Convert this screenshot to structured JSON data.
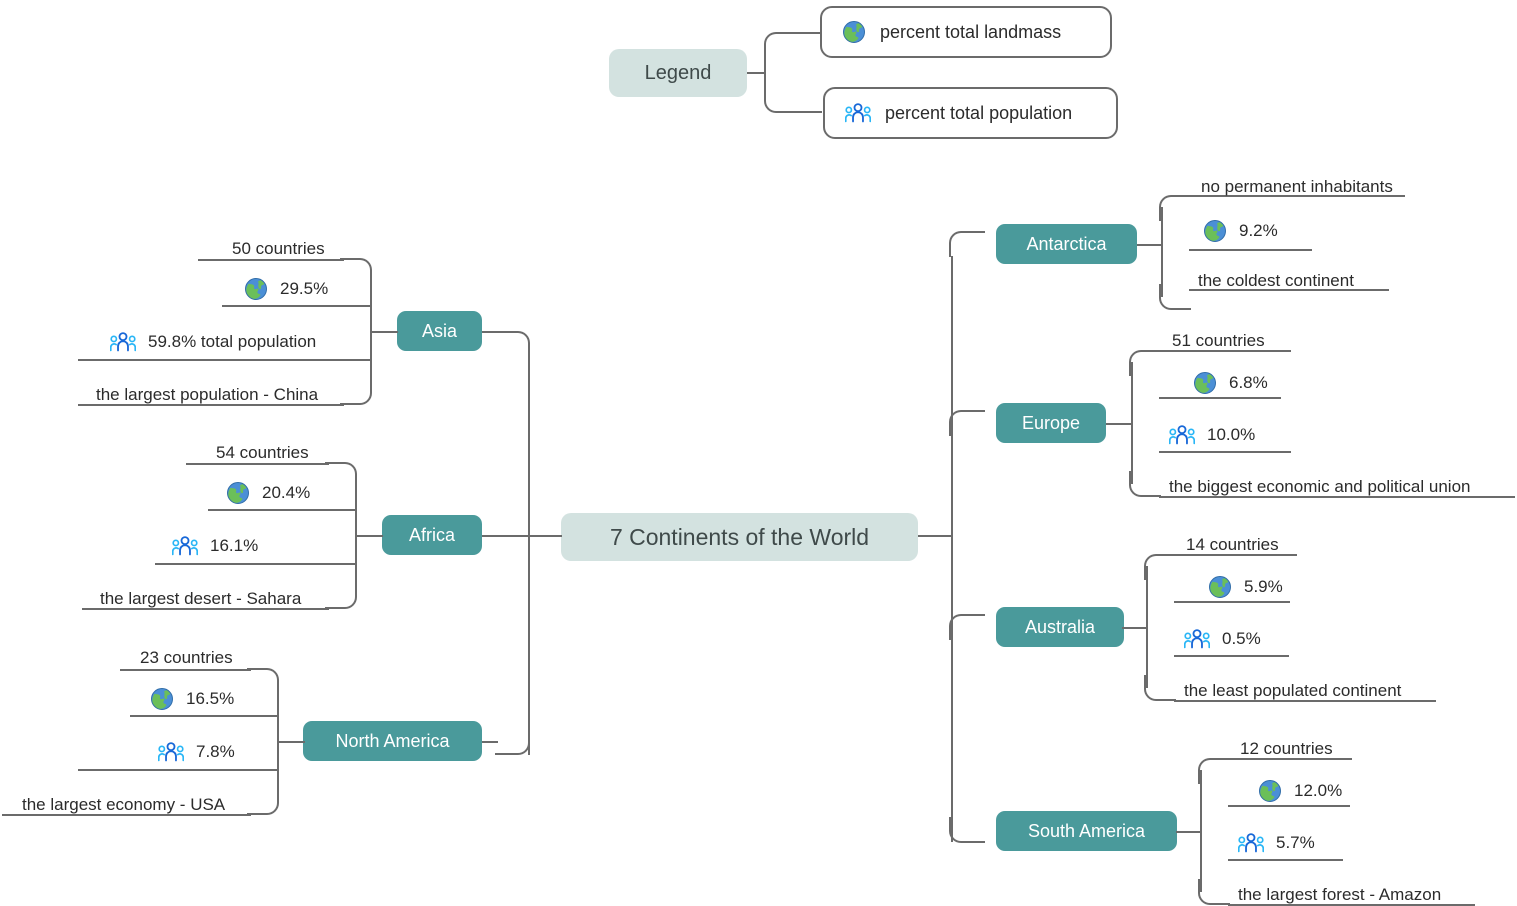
{
  "colors": {
    "branch_fill": "#4a9a9b",
    "root_fill": "#d3e2e0",
    "line": "#6b6b6b",
    "text": "#2b2b2b",
    "people_icon_dark": "#1868d8",
    "people_icon_light": "#29b6f6"
  },
  "root": {
    "label": "7 Continents of the World"
  },
  "legend": {
    "title": "Legend",
    "items": [
      {
        "icon": "globe-icon",
        "label": "percent total landmass"
      },
      {
        "icon": "people-icon",
        "label": "percent total population"
      }
    ]
  },
  "branches": [
    {
      "name": "Asia",
      "side": "left",
      "leaves": [
        {
          "icon": "none",
          "label": "50 countries"
        },
        {
          "icon": "globe-icon",
          "label": "29.5%"
        },
        {
          "icon": "people-icon",
          "label": "59.8% total population"
        },
        {
          "icon": "none",
          "label": "the largest population - China"
        }
      ]
    },
    {
      "name": "Africa",
      "side": "left",
      "leaves": [
        {
          "icon": "none",
          "label": "54 countries"
        },
        {
          "icon": "globe-icon",
          "label": "20.4%"
        },
        {
          "icon": "people-icon",
          "label": "16.1%"
        },
        {
          "icon": "none",
          "label": "the largest desert - Sahara"
        }
      ]
    },
    {
      "name": "North America",
      "side": "left",
      "leaves": [
        {
          "icon": "none",
          "label": "23 countries"
        },
        {
          "icon": "globe-icon",
          "label": "16.5%"
        },
        {
          "icon": "people-icon",
          "label": "7.8%"
        },
        {
          "icon": "none",
          "label": "the largest economy - USA"
        }
      ]
    },
    {
      "name": "Antarctica",
      "side": "right",
      "leaves": [
        {
          "icon": "none",
          "label": "no permanent inhabitants"
        },
        {
          "icon": "globe-icon",
          "label": "9.2%"
        },
        {
          "icon": "none",
          "label": "the coldest continent"
        }
      ]
    },
    {
      "name": "Europe",
      "side": "right",
      "leaves": [
        {
          "icon": "none",
          "label": "51 countries"
        },
        {
          "icon": "globe-icon",
          "label": "6.8%"
        },
        {
          "icon": "people-icon",
          "label": "10.0%"
        },
        {
          "icon": "none",
          "label": "the biggest economic and political union"
        }
      ]
    },
    {
      "name": "Australia",
      "side": "right",
      "leaves": [
        {
          "icon": "none",
          "label": "14 countries"
        },
        {
          "icon": "globe-icon",
          "label": "5.9%"
        },
        {
          "icon": "people-icon",
          "label": "0.5%"
        },
        {
          "icon": "none",
          "label": "the least populated continent"
        }
      ]
    },
    {
      "name": "South America",
      "side": "right",
      "leaves": [
        {
          "icon": "none",
          "label": "12 countries"
        },
        {
          "icon": "globe-icon",
          "label": "12.0%"
        },
        {
          "icon": "people-icon",
          "label": "5.7%"
        },
        {
          "icon": "none",
          "label": "the largest forest - Amazon"
        }
      ]
    }
  ]
}
